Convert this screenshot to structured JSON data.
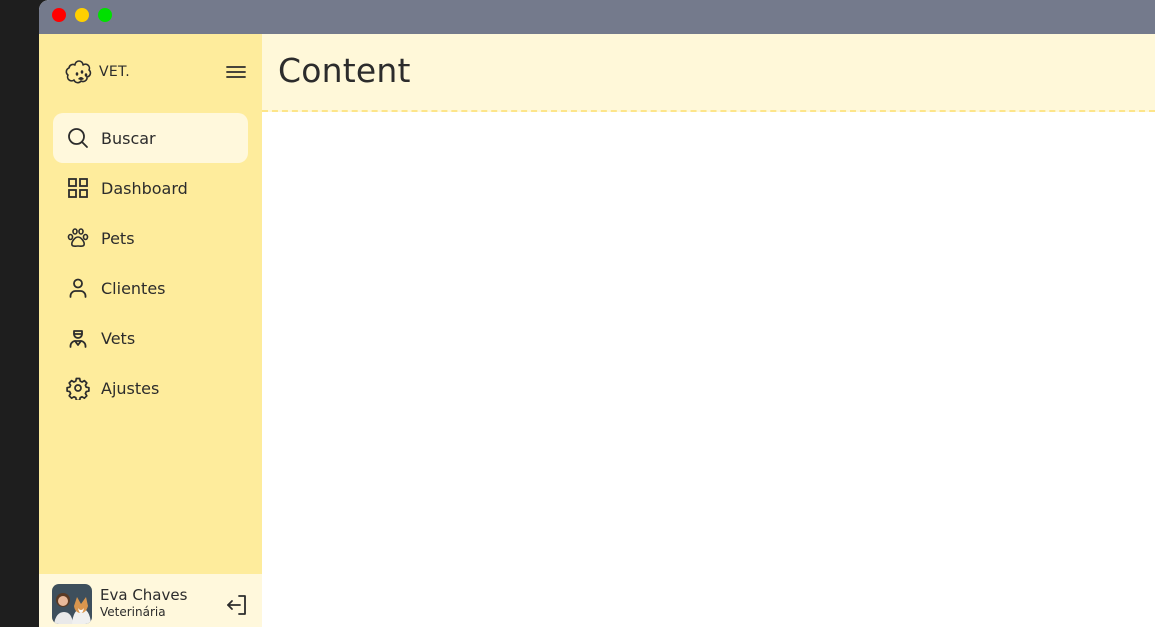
{
  "window": {
    "controls": [
      "close",
      "minimize",
      "maximize"
    ]
  },
  "brand": {
    "name": "VET.",
    "icon": "paw-cloud-logo-icon"
  },
  "sidebar": {
    "toggle_icon": "hamburger-menu-icon",
    "items": [
      {
        "label": "Buscar",
        "icon": "search-icon",
        "active": true
      },
      {
        "label": "Dashboard",
        "icon": "grid-icon",
        "active": false
      },
      {
        "label": "Pets",
        "icon": "paw-icon",
        "active": false
      },
      {
        "label": "Clientes",
        "icon": "user-icon",
        "active": false
      },
      {
        "label": "Vets",
        "icon": "vet-icon",
        "active": false
      },
      {
        "label": "Ajustes",
        "icon": "gear-icon",
        "active": false
      }
    ]
  },
  "user": {
    "name": "Eva Chaves",
    "role": "Veterinária",
    "logout_icon": "logout-icon"
  },
  "content": {
    "title": "Content"
  },
  "colors": {
    "sidebar_bg": "#feec9c",
    "active_bg": "#fff8dc",
    "header_bg": "#fff8d9",
    "titlebar": "#747a8c"
  }
}
